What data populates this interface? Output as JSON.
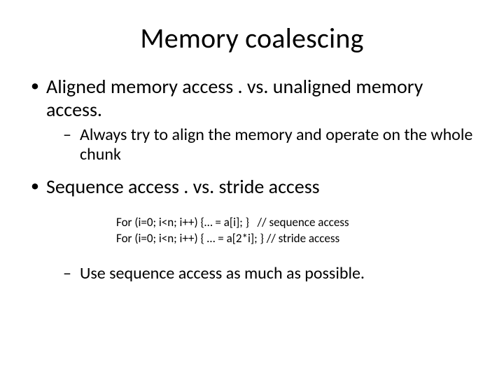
{
  "title": "Memory coalescing",
  "bullets": {
    "b1": "Aligned memory access . vs. unaligned memory access.",
    "b1_sub1": "Always try to align the memory and operate on the whole chunk",
    "b2": "Sequence access . vs. stride access",
    "b2_sub1": "Use sequence access as much as possible."
  },
  "code": {
    "line1": "For (i=0; i<n; i++) {… = a[i]; }   // sequence access",
    "line2": "For (i=0; i<n; i++) { … = a[2*i]; } // stride access"
  }
}
